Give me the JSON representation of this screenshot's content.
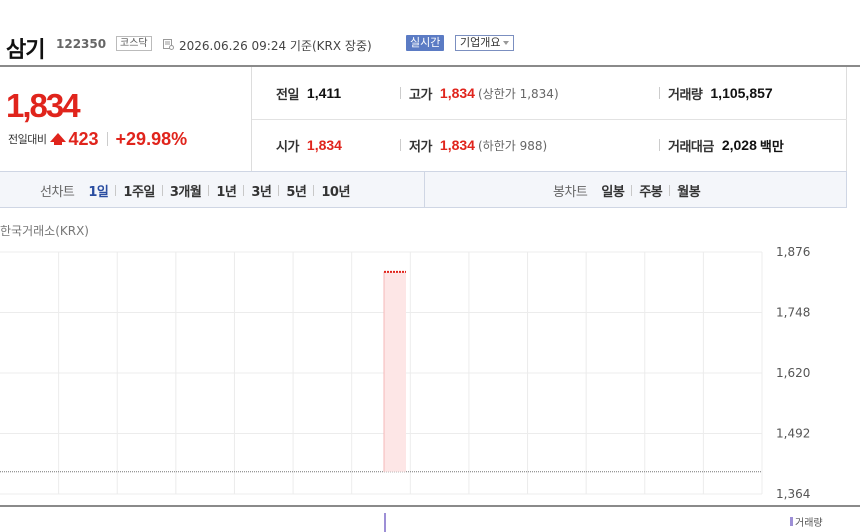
{
  "header": {
    "stock_name": "삼기",
    "stock_code": "122350",
    "market": "코스닥",
    "date_text": "2026.06.26 09:24  기준(KRX 장중)",
    "realtime_label": "실시간",
    "company_info_label": "기업개요"
  },
  "price": {
    "current": "1,834",
    "change_label": "전일대비",
    "change_value": "423",
    "change_pct": "+29.98%"
  },
  "quote": {
    "prev_close": {
      "label": "전일",
      "value": "1,411"
    },
    "high": {
      "label": "고가",
      "value": "1,834",
      "sub": "(상한가 1,834)"
    },
    "volume": {
      "label": "거래량",
      "value": "1,105,857"
    },
    "open": {
      "label": "시가",
      "value": "1,834"
    },
    "low": {
      "label": "저가",
      "value": "1,834",
      "sub": "(하한가 988)"
    },
    "amount": {
      "label": "거래대금",
      "value": "2,028",
      "unit": "백만"
    }
  },
  "tabs": {
    "line_chart_label": "선차트",
    "line_periods": [
      "1일",
      "1주일",
      "3개월",
      "1년",
      "3년",
      "5년",
      "10년"
    ],
    "active_period": "1일",
    "candle_chart_label": "봉차트",
    "candle_periods": [
      "일봉",
      "주봉",
      "월봉"
    ]
  },
  "chart_data": {
    "type": "line",
    "source_label": "한국거래소(KRX)",
    "y_ticks": [
      "1,876",
      "1,748",
      "1,620",
      "1,492",
      "1,364"
    ],
    "ylim": [
      1364,
      1876
    ],
    "prev_close": 1411,
    "price": 1834,
    "bar_color": "#fde6e6",
    "line_color": "#e0241c",
    "legend": "거래량"
  },
  "colors": {
    "up": "#e0241c",
    "active_tab": "#2a4da0",
    "realtime_bg": "#5b7bc4"
  }
}
